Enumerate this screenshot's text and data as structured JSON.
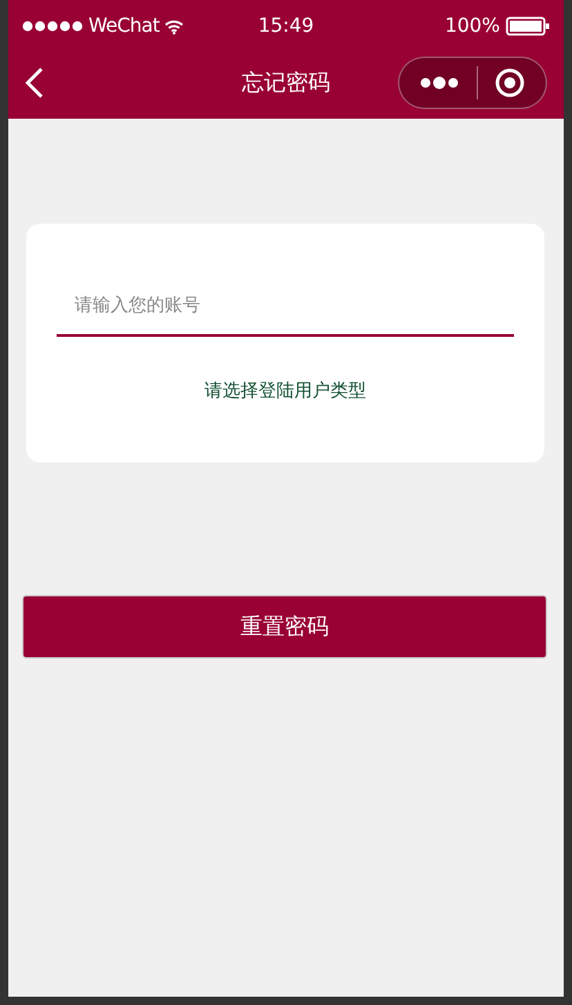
{
  "status_bar": {
    "carrier": "WeChat",
    "time": "15:49",
    "battery": "100%"
  },
  "nav": {
    "title": "忘记密码"
  },
  "form": {
    "account": {
      "placeholder": "请输入您的账号"
    },
    "user_type": "请选择登陆用户类型"
  },
  "submit": "重置密码"
}
